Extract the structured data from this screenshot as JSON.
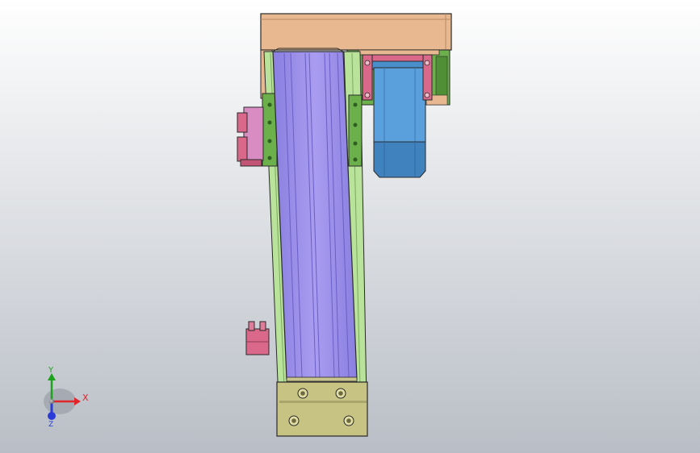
{
  "viewport": {
    "background_top": "#ffffff",
    "background_bottom": "#b9bec6"
  },
  "model": {
    "colors": {
      "top_block": "#e8b990",
      "bracket": "#6cb04c",
      "rail_green": "#b9e39a",
      "profile_purple": "#9b8ee8",
      "carriage": "#c6c383",
      "motor": "#5aa0dc",
      "mount_pink": "#d9688a",
      "sensor": "#d98cc2"
    }
  },
  "triad": {
    "x_label": "X",
    "y_label": "Y",
    "z_label": "Z",
    "x_color": "#e0262b",
    "y_color": "#1ea31e",
    "z_color": "#2b3bd8"
  }
}
